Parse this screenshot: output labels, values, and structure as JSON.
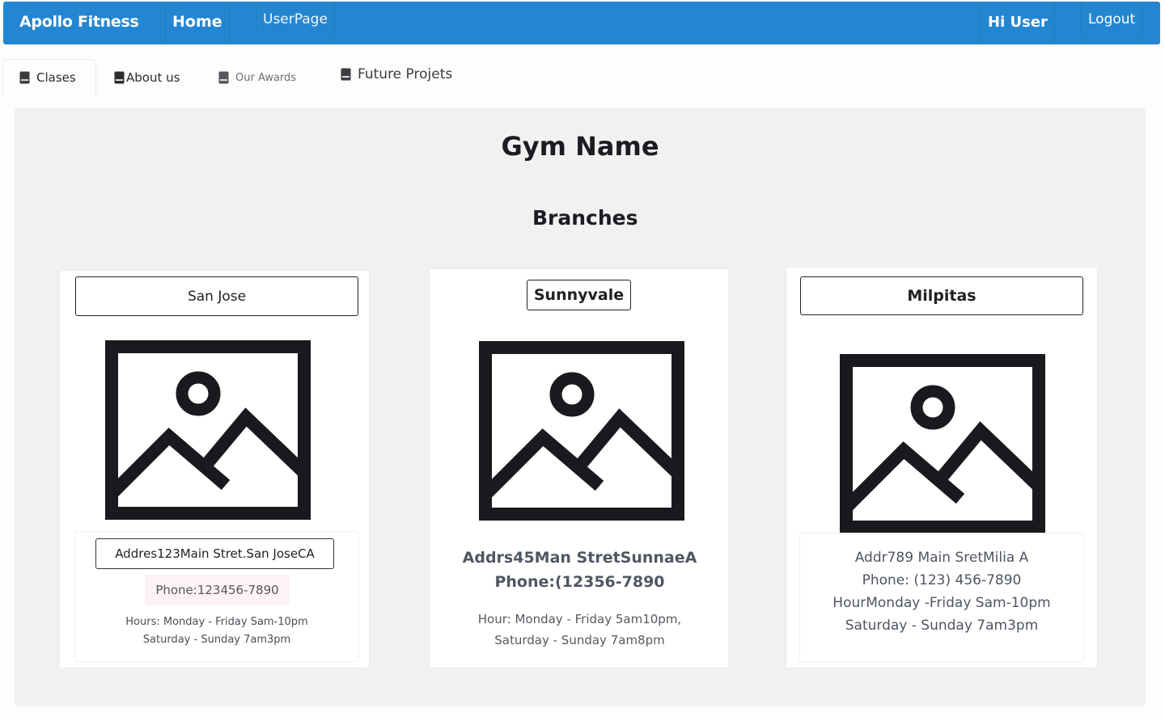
{
  "nav": {
    "brand": "Apollo Fitness",
    "home": "Home",
    "user_page": "UserPage",
    "greeting": "Hi User",
    "logout": "Logout",
    "bg_color": "#2486d1"
  },
  "tabs": [
    {
      "label": "Clases",
      "icon": "book-icon",
      "active": true
    },
    {
      "label": "About us",
      "icon": "book-icon"
    },
    {
      "label": "Our Awards",
      "icon": "book-icon"
    },
    {
      "label": "Future Projets",
      "icon": "book-icon"
    }
  ],
  "main": {
    "gym_name": "Gym Name",
    "branches_heading": "Branches"
  },
  "branches": [
    {
      "name": "San Jose",
      "image_icon": "image-placeholder-icon",
      "address": "Addres123Main Stret.San JoseCA",
      "phone": "Phone:123456-7890",
      "hours_line1": "Hours: Monday - Friday Sam-10pm",
      "hours_line2": "Saturday - Sunday 7am3pm"
    },
    {
      "name": "Sunnyvale",
      "image_icon": "image-placeholder-icon",
      "address": "Addrs45Man StretSunnaeA",
      "phone": "Phone:(12356-7890",
      "hours_line1": "Hour: Monday - Friday 5am10pm,",
      "hours_line2": "Saturday - Sunday 7am8pm"
    },
    {
      "name": "Milpitas",
      "image_icon": "image-placeholder-icon",
      "address": "Addr789 Main SretMilia A",
      "phone": "Phone: (123) 456-7890",
      "hours_line1": "HourMonday -Friday Sam-10pm",
      "hours_line2": "Saturday - Sunday 7am3pm"
    }
  ]
}
